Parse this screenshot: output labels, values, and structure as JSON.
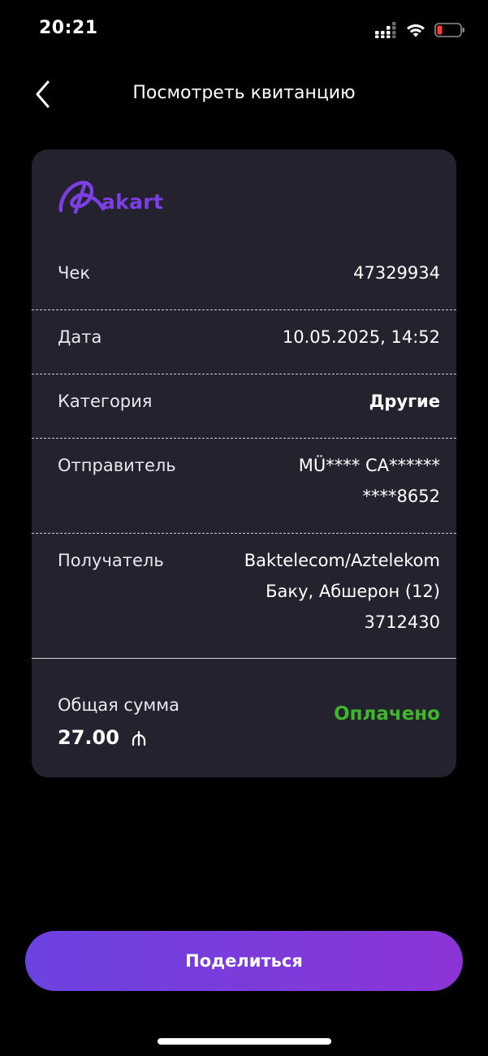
{
  "status_bar": {
    "time": "20:21"
  },
  "header": {
    "title": "Посмотреть квитанцию"
  },
  "receipt": {
    "brand_name": "akart",
    "check_label": "Чек",
    "check_value": "47329934",
    "date_label": "Дата",
    "date_value": "10.05.2025, 14:52",
    "category_label": "Категория",
    "category_value": "Другие",
    "sender_label": "Отправитель",
    "sender_name": "MÜ**** CA******",
    "sender_card": "****8652",
    "recipient_label": "Получатель",
    "recipient_name": "Baktelecom/Aztelekom",
    "recipient_region": "Баку, Абшерон (12)",
    "recipient_account": "3712430",
    "total_label": "Общая сумма",
    "total_amount": "27.00",
    "currency_icon": "azn-manat-icon",
    "status": "Оплачено"
  },
  "actions": {
    "share_label": "Поделиться"
  },
  "colors": {
    "background": "#000000",
    "card": "#24222f",
    "brand": "#7b3fe4",
    "paid": "#3fb72b",
    "button_start": "#6b42e0",
    "button_end": "#8b34d6"
  }
}
